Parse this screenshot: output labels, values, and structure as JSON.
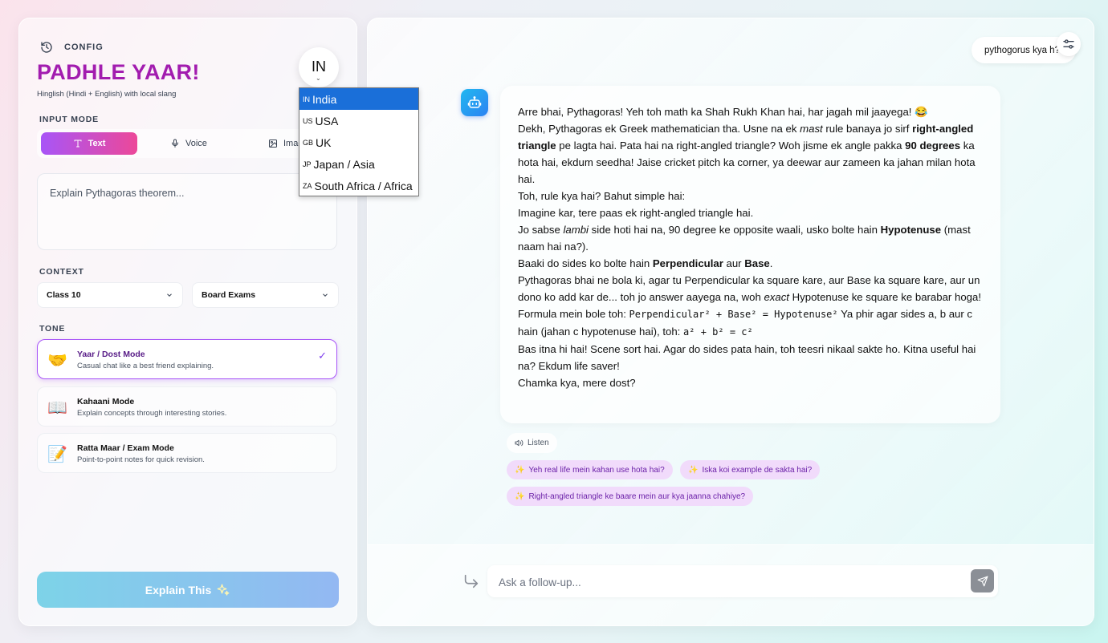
{
  "sidebar": {
    "config_label": "CONFIG",
    "app_title": "PADHLE YAAR!",
    "subtitle": "Hinglish (Hindi + English) with local slang",
    "language_button": "IN",
    "input_mode_label": "INPUT MODE",
    "modes": [
      {
        "label": "Text",
        "icon": "text-icon",
        "active": true
      },
      {
        "label": "Voice",
        "icon": "mic-icon",
        "active": false
      },
      {
        "label": "Image",
        "icon": "image-icon",
        "active": false
      }
    ],
    "input_placeholder": "Explain Pythagoras theorem...",
    "context_label": "CONTEXT",
    "class_select": "Class 10",
    "exam_select": "Board Exams",
    "tone_label": "TONE",
    "tones": [
      {
        "title": "Yaar / Dost Mode",
        "desc": "Casual chat like a best friend explaining.",
        "emoji": "🤝",
        "selected": true
      },
      {
        "title": "Kahaani Mode",
        "desc": "Explain concepts through interesting stories.",
        "emoji": "📖",
        "selected": false
      },
      {
        "title": "Ratta Maar / Exam Mode",
        "desc": "Point-to-point notes for quick revision.",
        "emoji": "📝",
        "selected": false
      }
    ],
    "explain_button": "Explain This"
  },
  "language_dropdown": {
    "items": [
      {
        "code": "IN",
        "label": "India",
        "selected": true
      },
      {
        "code": "US",
        "label": "USA",
        "selected": false
      },
      {
        "code": "GB",
        "label": "UK",
        "selected": false
      },
      {
        "code": "JP",
        "label": "Japan / Asia",
        "selected": false
      },
      {
        "code": "ZA",
        "label": "South Africa / Africa",
        "selected": false
      }
    ]
  },
  "chat": {
    "user_message": "pythogorus kya h?",
    "listen_label": "Listen",
    "suggestions": [
      "Yeh real life mein kahan use hota hai?",
      "Iska koi example de sakta hai?",
      "Right-angled triangle ke baare mein aur kya jaanna chahiye?"
    ],
    "followup_placeholder": "Ask a follow-up..."
  }
}
